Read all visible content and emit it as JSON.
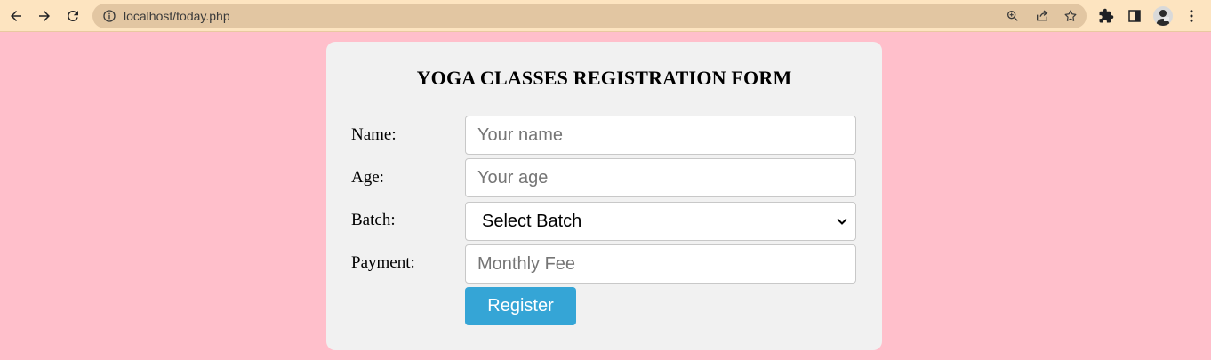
{
  "browser": {
    "url": "localhost/today.php",
    "icons": {
      "back": "back-arrow-icon",
      "forward": "forward-arrow-icon",
      "reload": "reload-icon",
      "site_info": "info-icon",
      "zoom": "zoom-icon",
      "share": "share-icon",
      "bookmark": "star-icon",
      "extensions": "puzzle-icon",
      "side_panel": "side-panel-icon",
      "menu": "more-vert-icon"
    },
    "colors": {
      "toolbar": "#fde4c0",
      "omnibox": "#e2c6a2"
    }
  },
  "page": {
    "background": "#ffbfcb",
    "form": {
      "title": "YOGA CLASSES REGISTRATION FORM",
      "fields": {
        "name": {
          "label": "Name:",
          "placeholder": "Your name",
          "value": ""
        },
        "age": {
          "label": "Age:",
          "placeholder": "Your age",
          "value": ""
        },
        "batch": {
          "label": "Batch:",
          "selected": "Select Batch"
        },
        "payment": {
          "label": "Payment:",
          "placeholder": "Monthly Fee",
          "value": ""
        }
      },
      "submit_label": "Register",
      "colors": {
        "card": "#f1f1f1",
        "button": "#35a5d6"
      }
    }
  }
}
